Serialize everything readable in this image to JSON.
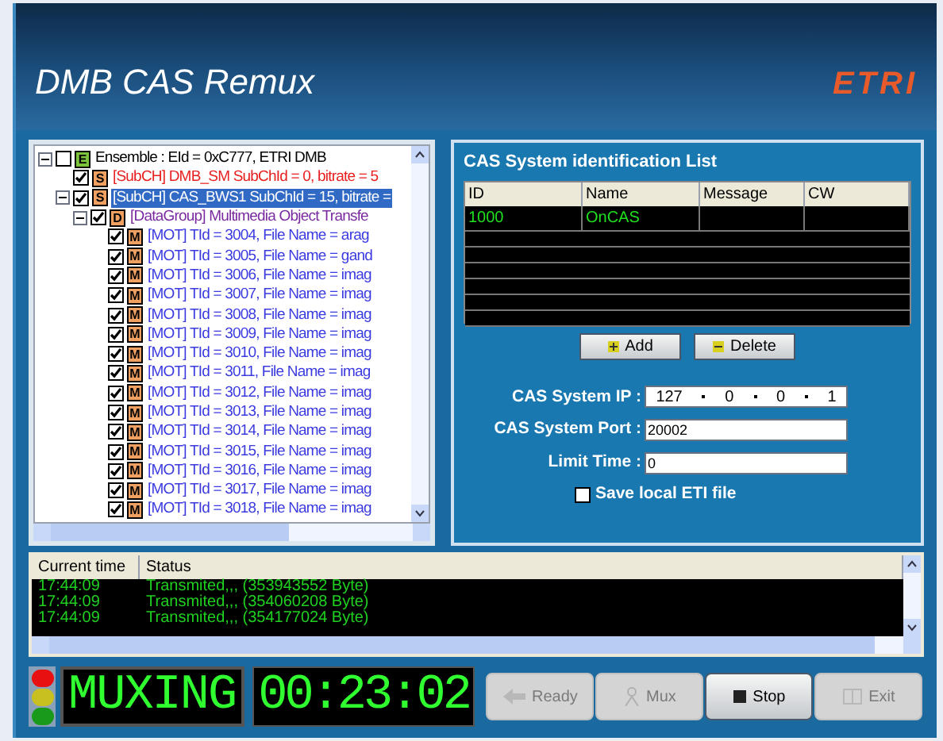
{
  "window": {
    "title": "DMB CAS Remux",
    "logo": "ETRI"
  },
  "tree": [
    {
      "kind": "ensemble",
      "label": "Ensemble :  EId = 0xC777, ETRI DMB",
      "badge": "E",
      "checked": false,
      "expanded": true,
      "selected": false,
      "children": [
        {
          "kind": "subch",
          "label": "[SubCH] DMB_SM SubChId = 0, bitrate = 5",
          "badge": "S",
          "checked": true,
          "selected": false
        },
        {
          "kind": "subch",
          "label": "[SubCH] CAS_BWS1 SubChId = 15, bitrate =",
          "badge": "S",
          "checked": true,
          "expanded": true,
          "selected": true,
          "children": [
            {
              "kind": "datagroup",
              "label": "[DataGroup] Multimedia Object Transfe",
              "badge": "D",
              "checked": true,
              "expanded": true,
              "selected": false,
              "children": [
                {
                  "kind": "mot",
                  "label": "[MOT] TId = 3004, File Name = arag",
                  "badge": "M",
                  "checked": true,
                  "selected": false
                },
                {
                  "kind": "mot",
                  "label": "[MOT] TId = 3005, File Name = gand",
                  "badge": "M",
                  "checked": true,
                  "selected": false
                },
                {
                  "kind": "mot",
                  "label": "[MOT] TId = 3006, File Name = imag",
                  "badge": "M",
                  "checked": true,
                  "selected": false
                },
                {
                  "kind": "mot",
                  "label": "[MOT] TId = 3007, File Name = imag",
                  "badge": "M",
                  "checked": true,
                  "selected": false
                },
                {
                  "kind": "mot",
                  "label": "[MOT] TId = 3008, File Name = imag",
                  "badge": "M",
                  "checked": true,
                  "selected": false
                },
                {
                  "kind": "mot",
                  "label": "[MOT] TId = 3009, File Name = imag",
                  "badge": "M",
                  "checked": true,
                  "selected": false
                },
                {
                  "kind": "mot",
                  "label": "[MOT] TId = 3010, File Name = imag",
                  "badge": "M",
                  "checked": true,
                  "selected": false
                },
                {
                  "kind": "mot",
                  "label": "[MOT] TId = 3011, File Name = imag",
                  "badge": "M",
                  "checked": true,
                  "selected": false
                },
                {
                  "kind": "mot",
                  "label": "[MOT] TId = 3012, File Name = imag",
                  "badge": "M",
                  "checked": true,
                  "selected": false
                },
                {
                  "kind": "mot",
                  "label": "[MOT] TId = 3013, File Name = imag",
                  "badge": "M",
                  "checked": true,
                  "selected": false
                },
                {
                  "kind": "mot",
                  "label": "[MOT] TId = 3014, File Name = imag",
                  "badge": "M",
                  "checked": true,
                  "selected": false
                },
                {
                  "kind": "mot",
                  "label": "[MOT] TId = 3015, File Name = imag",
                  "badge": "M",
                  "checked": true,
                  "selected": false
                },
                {
                  "kind": "mot",
                  "label": "[MOT] TId = 3016, File Name = imag",
                  "badge": "M",
                  "checked": true,
                  "selected": false
                },
                {
                  "kind": "mot",
                  "label": "[MOT] TId = 3017, File Name = imag",
                  "badge": "M",
                  "checked": true,
                  "selected": false
                },
                {
                  "kind": "mot",
                  "label": "[MOT] TId = 3018, File Name = imag",
                  "badge": "M",
                  "checked": true,
                  "selected": false
                }
              ]
            }
          ]
        }
      ]
    }
  ],
  "cas": {
    "title": "CAS System identification List",
    "columns": [
      "ID",
      "Name",
      "Message",
      "CW"
    ],
    "rows": [
      [
        "1000",
        "OnCAS",
        "",
        ""
      ]
    ],
    "buttons": [
      {
        "label": "Add",
        "kind": "add"
      },
      {
        "label": "Delete",
        "kind": "delete"
      }
    ],
    "ip_label": "CAS System IP :",
    "ip": [
      "127",
      "0",
      "0",
      "1"
    ],
    "port_label": "CAS System Port :",
    "port": "20002",
    "limit_label": "Limit Time :",
    "limit": "0",
    "save_label": "Save local ETI file",
    "save_checked": false
  },
  "log": {
    "columns": [
      "Current time",
      "Status"
    ],
    "rows": [
      [
        "17:44:09",
        "Transmited,,, (353943552 Byte)"
      ],
      [
        "17:44:09",
        "Transmited,,, (354060208 Byte)"
      ],
      [
        "17:44:09",
        "Transmited,,, (354177024 Byte)"
      ]
    ]
  },
  "lights": [
    {
      "color": "#e81010"
    },
    {
      "color": "#c8c020"
    },
    {
      "color": "#1a9a1a"
    }
  ],
  "status_display": "MUXING",
  "timer": "00:23:02",
  "controls": [
    {
      "label": "Ready",
      "kind": "ready",
      "disabled": true
    },
    {
      "label": "Mux",
      "kind": "mux",
      "disabled": true
    },
    {
      "label": "Stop",
      "kind": "stop",
      "disabled": false
    },
    {
      "label": "Exit",
      "kind": "exit",
      "disabled": true
    }
  ]
}
